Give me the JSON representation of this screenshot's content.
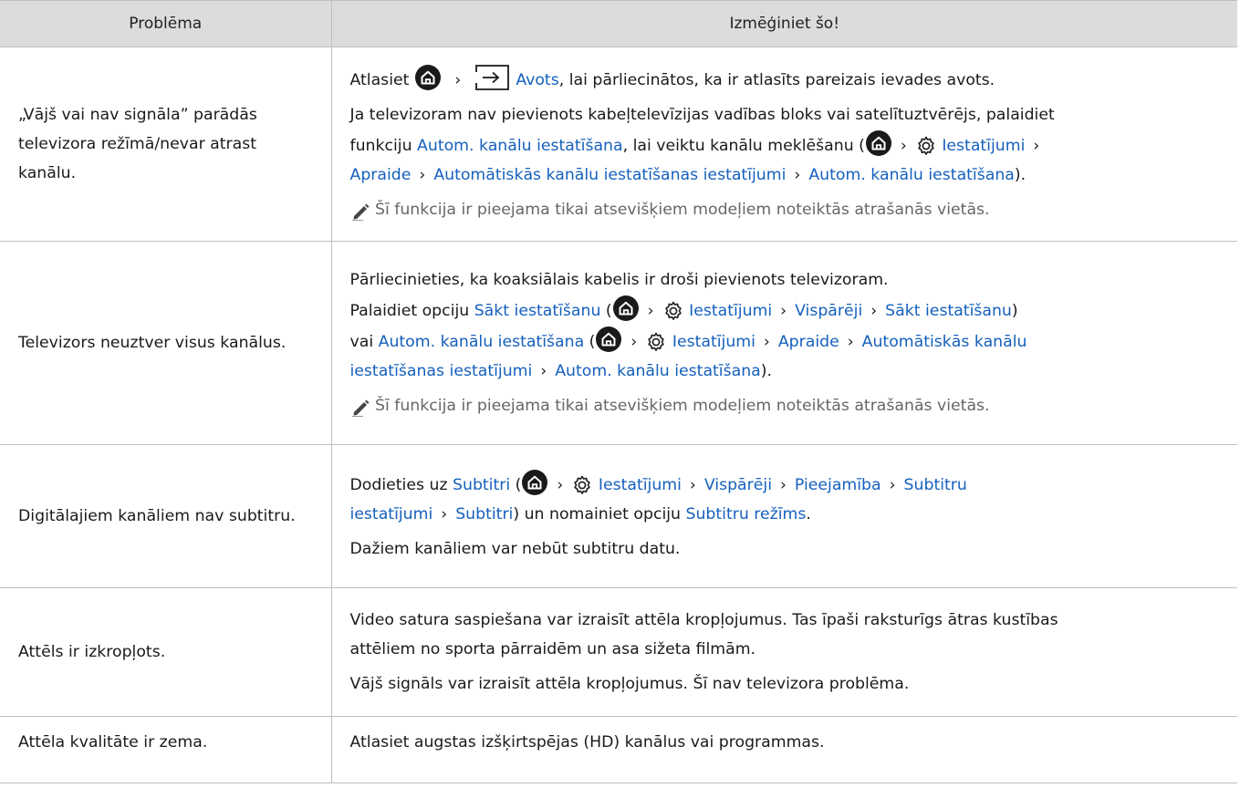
{
  "header": {
    "col1": "Problēma",
    "col2": "Izmēģiniet šo!"
  },
  "rows": [
    {
      "problem": "„Vājš vai nav signāla” parādās televizora režīmā/nevar atrast kanālu.",
      "s1": {
        "a": "Atlasiet",
        "avots": "Avots",
        "b": ", lai pārliecinātos, ka ir atlasīts pareizais ievades avots."
      },
      "s2": {
        "l1": "Ja televizoram nav pievienots kabeļtelevīzijas vadības bloks vai satelītuztvērējs, palaidiet",
        "a": "funkciju ",
        "link1": "Autom. kanālu iestatīšana",
        "b": ", lai veiktu kanālu meklēšanu (",
        "settings": "Iestatījumi",
        "apraide": "Apraide",
        "auto_settings": "Automātiskās kanālu iestatīšanas iestatījumi",
        "link2": "Autom. kanālu iestatīšana",
        "end": ")."
      },
      "note": "Šī funkcija ir pieejama tikai atsevišķiem modeļiem noteiktās atrašanās vietās."
    },
    {
      "problem": "Televizors neuztver visus kanālus.",
      "p1": "Pārliecinieties, ka koaksiālais kabelis ir droši pievienots televizoram.",
      "p2": {
        "a": "Palaidiet opciju ",
        "sakt": "Sākt iestatīšanu",
        "paren": " (",
        "settings": "Iestatījumi",
        "visp": "Vispārēji",
        "sakt2": "Sākt iestatīšanu",
        "close": ")"
      },
      "p3": {
        "a": "vai ",
        "auto": "Autom. kanālu iestatīšana",
        "paren": " (",
        "settings": "Iestatījumi",
        "apraide": "Apraide",
        "auto_settings_a": "Automātiskās kanālu",
        "auto_settings_b": "iestatīšanas iestatījumi",
        "auto2": "Autom. kanālu iestatīšana",
        "end": ")."
      },
      "note": "Šī funkcija ir pieejama tikai atsevišķiem modeļiem noteiktās atrašanās vietās."
    },
    {
      "problem": "Digitālajiem kanāliem nav subtitru.",
      "p1": {
        "a": "Dodieties uz ",
        "subtitri": "Subtitri",
        "paren": " (",
        "settings": "Iestatījumi",
        "visp": "Vispārēji",
        "pieej": "Pieejamība",
        "sub_settings_a": "Subtitru",
        "sub_settings_b": "iestatījumi",
        "subtitri2": "Subtitri",
        "b": ") un nomainiet opciju ",
        "mode": "Subtitru režīms",
        "end": "."
      },
      "p2": "Dažiem kanāliem var nebūt subtitru datu."
    },
    {
      "problem": "Attēls ir izkropļots.",
      "p1a": "Video satura saspiešana var izraisīt attēla kropļojumus. Tas īpaši raksturīgs ātras kustības",
      "p1b": "attēliem no sporta pārraidēm un asa sižeta filmām.",
      "p2": "Vājš signāls var izraisīt attēla kropļojumus. Šī nav televizora problēma."
    },
    {
      "problem": "Attēla kvalitāte ir zema.",
      "p1": "Atlasiet augstas izšķirtspējas (HD) kanālus vai programmas."
    }
  ],
  "symbols": {
    "sep": "›"
  },
  "colors": {
    "link": "#1560bd",
    "header_bg": "#dcdcdc",
    "note": "#666666"
  }
}
